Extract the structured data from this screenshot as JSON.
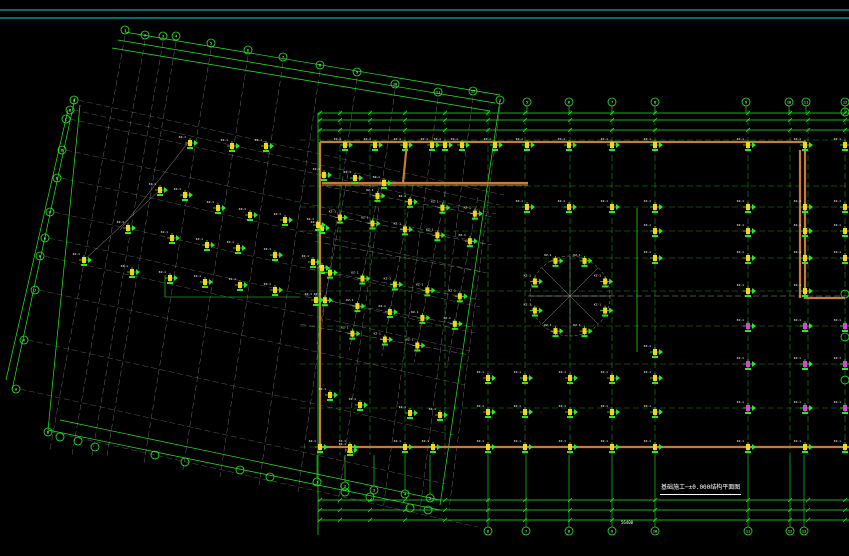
{
  "app": {
    "title": ""
  },
  "drawing": {
    "plan_title": "基础施工─±0.000结构平面图",
    "colors": {
      "background": "#000000",
      "axis_grid": "#22ee22",
      "dim_line": "#22ee22",
      "axis_bubble": "#22ee22",
      "wall_beam": "#c87a3a",
      "pile_cap_yellow": "#ffd21a",
      "pile_cap_magenta": "#e040e0",
      "center_line": "#bbbbbb",
      "label_text": "#ffffff",
      "top_rule": "#19d0e0"
    },
    "column_label": "KZ-1",
    "pile_label": "ZJ1",
    "axis_numbers_top": [
      "1",
      "2",
      "3",
      "4",
      "5",
      "6",
      "7",
      "8",
      "9",
      "10",
      "11",
      "12"
    ],
    "axis_numbers_left": [
      "A",
      "B",
      "C",
      "D",
      "E",
      "F",
      "G",
      "H",
      "J",
      "K"
    ],
    "axis_numbers_bottom": [
      "1",
      "2",
      "3",
      "4",
      "5",
      "6",
      "7",
      "8",
      "9",
      "10",
      "11",
      "12",
      "13",
      "14",
      "15"
    ],
    "dimension_total": "56400"
  }
}
